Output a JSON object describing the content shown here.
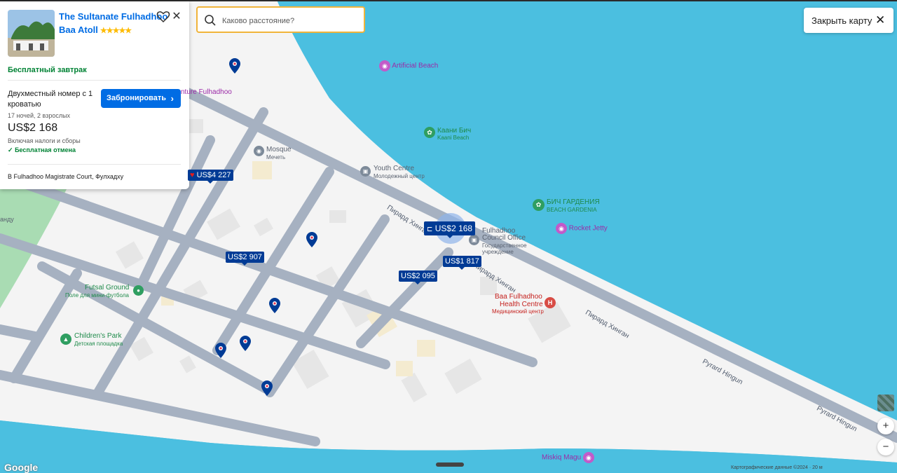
{
  "card": {
    "hotel_name": "The Sultanate Fulhadhoo",
    "atoll": "Baa Atoll",
    "stars": "★★★★★",
    "breakfast": "Бесплатный завтрак",
    "room": "Двухместный номер с 1 кроватью",
    "book_label": "Забронировать",
    "nights": "17 ночей, 2 взрослых",
    "price": "US$2 168",
    "taxes": "Включая налоги и сборы",
    "cancel": "Бесплатная отмена",
    "address": "В Fulhadhoo Magistrate Court, Фулхадху"
  },
  "search": {
    "placeholder": "Каково расстояние?"
  },
  "close_map": "Закрыть карту",
  "pins": {
    "p4227": "US$4 227",
    "p2907": "US$2 907",
    "p2095": "US$2 095",
    "p1817": "US$1 817",
    "p2168": "US$2 168"
  },
  "pois": {
    "artificial_beach": "Artificial Beach",
    "kaani_ru": "Каани Бич",
    "kaani_en": "Kaani Beach",
    "mosque_en": "Mosque",
    "mosque_ru": "Мечеть",
    "youth_en": "Youth Centre",
    "youth_ru": "Молодежный центр",
    "gardenia_ru": "БИЧ ГАРДЕНИЯ",
    "gardenia_en": "BEACH GARDENIA",
    "rocket_jetty": "Rocket Jetty",
    "council_1": "Fulhadhoo",
    "council_2": "Council Office",
    "council_3": "Государственное",
    "council_4": "учреждение",
    "health_1": "Baa Fulhadhoo",
    "health_2": "Health Centre",
    "health_3": "Медицинский центр",
    "futsal_en": "Futsal Ground",
    "futsal_ru": "Поле для мини-футбола",
    "children_en": "Children's Park",
    "children_ru": "Детская площадка",
    "miskiq": "Miskiq Magu",
    "venture": "nture Fulhadhoo",
    "andu": "анду"
  },
  "streets": {
    "s1": "Пирард Хинган",
    "s2": "Пирард Хинган",
    "s3": "Пирард Хинган",
    "s4": "Pyrard Hingun",
    "s5": "Pyrard Hingun"
  },
  "google": "Google",
  "legal": "Картографические данные ©2024 · 20 м"
}
